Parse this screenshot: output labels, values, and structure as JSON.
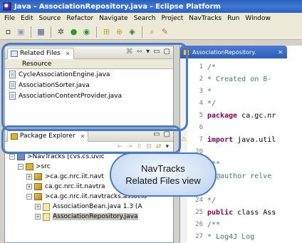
{
  "window": {
    "title": "Java - AssociationRepository.java - Eclipse Platform"
  },
  "menu": [
    "File",
    "Edit",
    "Source",
    "Refactor",
    "Navigate",
    "Search",
    "Project",
    "NavTracks",
    "Run",
    "Window"
  ],
  "toolbar": {
    "icons": [
      "new-icon",
      "save-icon",
      "print-icon",
      "debug-icon",
      "run-icon",
      "external-tools-icon",
      "new-package-icon",
      "new-class-icon",
      "open-type-icon",
      "search-icon",
      "pencil-icon"
    ]
  },
  "related_files": {
    "tab_label": "Related Files",
    "column_header": "Resource",
    "items": [
      "CycleAssociationEngine.java",
      "AssociationSorter.java",
      "AssociationContentProvider.java"
    ]
  },
  "package_explorer": {
    "tab_label": "Package Explorer",
    "rows": [
      {
        "label": ">NavTracks [cvs.cs.uvic",
        "level": 0
      },
      {
        "label": ">src",
        "level": 1
      },
      {
        "label": ">ca.gc.nrc.iit.navt",
        "level": 2
      },
      {
        "label": "ca.gc.nrc.iit.navtra",
        "level": 2
      },
      {
        "label": ">ca.gc.nrc.iit.navtracks.associa",
        "level": 2
      },
      {
        "label": "AssociationBean.java 1.3 (A",
        "level": 3
      },
      {
        "label": "AssociationRepository.java",
        "level": 3,
        "selected": true
      }
    ]
  },
  "editor": {
    "tab_label": "AssociationRepository.",
    "lines": [
      {
        "num": "1",
        "text": "/*",
        "kind": "comment"
      },
      {
        "num": "2",
        "text": " * Created on 8-",
        "kind": "comment"
      },
      {
        "num": "3",
        "text": " *",
        "kind": "comment"
      },
      {
        "num": "4",
        "text": " */",
        "kind": "comment"
      },
      {
        "num": "5",
        "text": "package ca.gc.nr",
        "kind": "keyword"
      },
      {
        "num": "6",
        "text": "",
        "kind": "plain"
      },
      {
        "num": "7",
        "text": "import java.util",
        "kind": "keyword",
        "warning": true
      },
      {
        "num": "20",
        "text": "",
        "kind": "plain"
      },
      {
        "num": "21",
        "text": "/**",
        "kind": "comment"
      },
      {
        "num": "22",
        "text": " * @author relve",
        "kind": "comment"
      },
      {
        "num": "23",
        "text": " *",
        "kind": "comment"
      },
      {
        "num": "24",
        "text": " */",
        "kind": "comment"
      },
      {
        "num": "25",
        "text": "public class Ass",
        "kind": "keyword"
      },
      {
        "num": "26",
        "text": "    /**",
        "kind": "comment"
      },
      {
        "num": "27",
        "text": "     * Log4J Log",
        "kind": "comment"
      }
    ]
  },
  "callout": {
    "line1": "NavTracks",
    "line2": "Related Files view"
  },
  "colors": {
    "highlight": "#4a7ac4",
    "titlebar": "#2a5fb8"
  }
}
